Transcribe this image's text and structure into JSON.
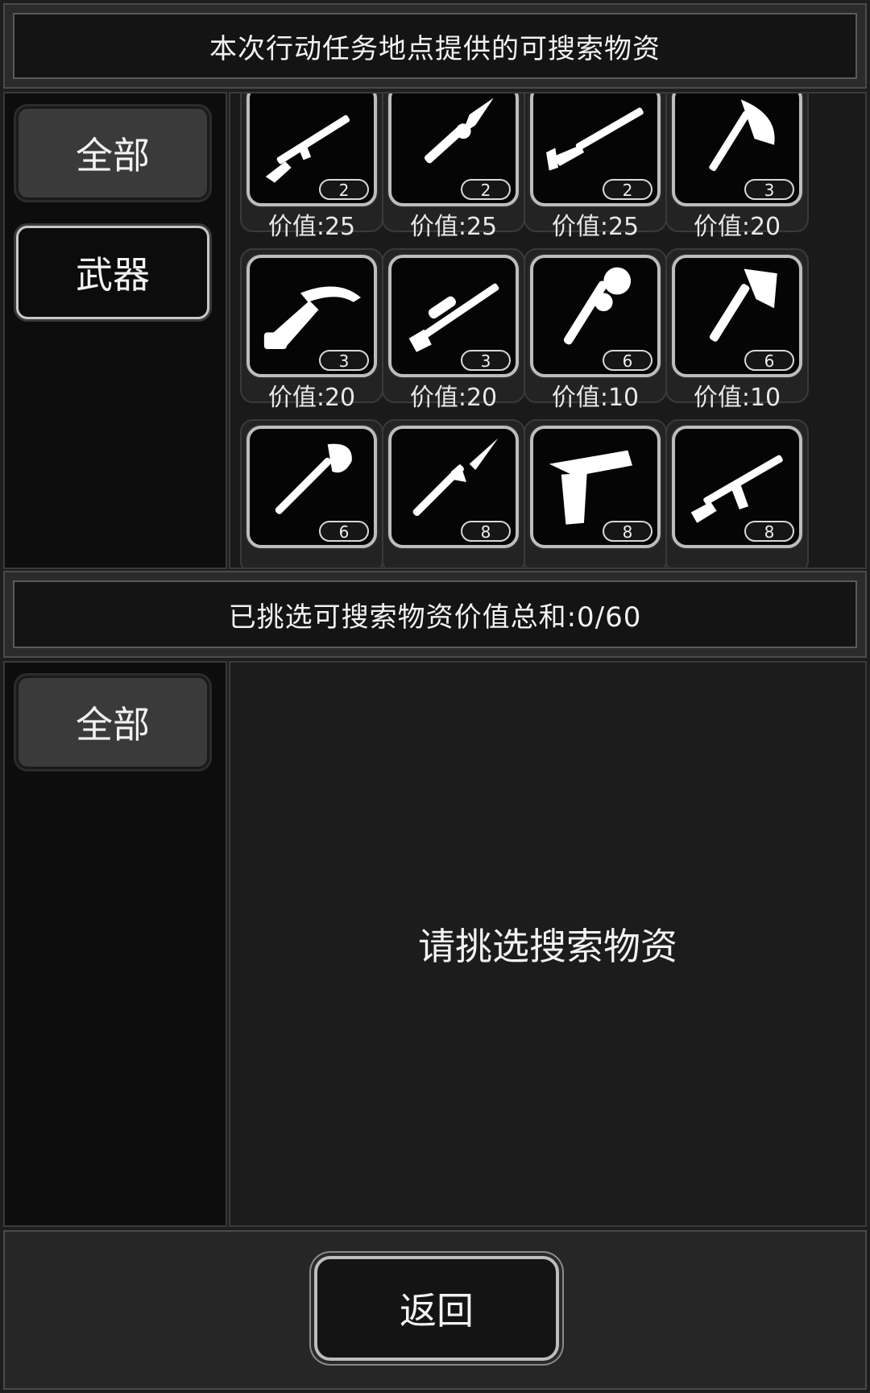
{
  "top_banner": {
    "text": "本次行动任务地点提供的可搜索物资"
  },
  "available": {
    "tabs": [
      {
        "label": "全部",
        "active": false
      },
      {
        "label": "武器",
        "active": true
      }
    ],
    "items": [
      {
        "icon": "rifle-icon",
        "count": "2",
        "price": "价值:25"
      },
      {
        "icon": "spear-icon",
        "count": "2",
        "price": "价值:25"
      },
      {
        "icon": "shotgun-icon",
        "count": "2",
        "price": "价值:25"
      },
      {
        "icon": "axe-icon",
        "count": "3",
        "price": "价值:20"
      },
      {
        "icon": "crossbow-icon",
        "count": "3",
        "price": "价值:20"
      },
      {
        "icon": "sniper-rifle-icon",
        "count": "3",
        "price": "价值:20"
      },
      {
        "icon": "spiked-club-icon",
        "count": "6",
        "price": "价值:10"
      },
      {
        "icon": "hatchet-icon",
        "count": "6",
        "price": "价值:10"
      },
      {
        "icon": "shovel-icon",
        "count": "6",
        "price": ""
      },
      {
        "icon": "spear-tip-icon",
        "count": "8",
        "price": ""
      },
      {
        "icon": "pistol-icon",
        "count": "8",
        "price": ""
      },
      {
        "icon": "assault-rifle-icon",
        "count": "8",
        "price": ""
      }
    ]
  },
  "selected_banner": {
    "text": "已挑选可搜索物资价值总和:0/60"
  },
  "selected": {
    "tabs": [
      {
        "label": "全部"
      }
    ],
    "empty_text": "请挑选搜索物资"
  },
  "footer": {
    "back_label": "返回"
  }
}
